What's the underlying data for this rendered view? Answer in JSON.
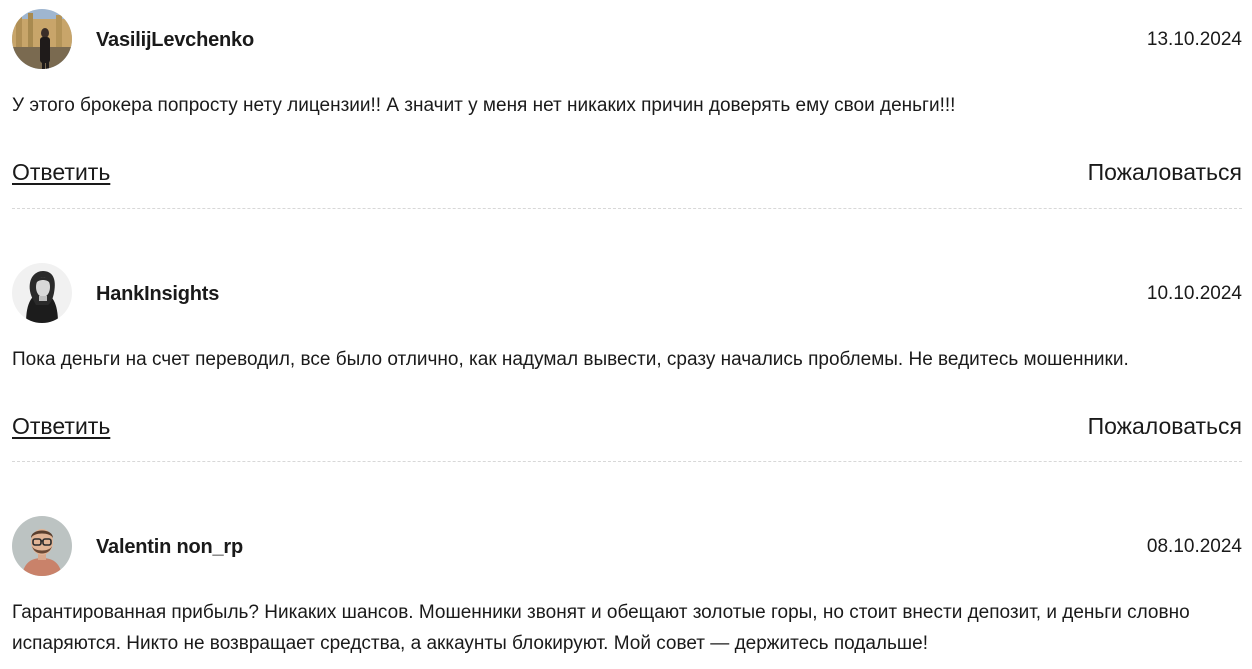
{
  "comments": [
    {
      "author": "VasilijLevchenko",
      "date": "13.10.2024",
      "text": "У этого брокера попросту нету лицензии!! А значит у меня нет никаких причин доверять ему свои деньги!!!",
      "reply_label": "Ответить",
      "report_label": "Пожаловаться"
    },
    {
      "author": "HankInsights",
      "date": "10.10.2024",
      "text": "Пока деньги на счет переводил, все было отлично, как надумал вывести, сразу начались проблемы. Не ведитесь мошенники.",
      "reply_label": "Ответить",
      "report_label": "Пожаловаться"
    },
    {
      "author": "Valentin non_rp",
      "date": "08.10.2024",
      "text": "Гарантированная прибыль? Никаких шансов. Мошенники звонят и обещают золотые горы, но стоит внести депозит, и деньги словно испаряются. Никто не возвращает средства, а аккаунты блокируют. Мой совет — держитесь подальше!"
    }
  ],
  "icons": {
    "avatar_1": "avatar-photo-man-outdoors",
    "avatar_2": "avatar-photo-man-long-hair",
    "avatar_3": "avatar-photo-man-glasses-beard"
  }
}
